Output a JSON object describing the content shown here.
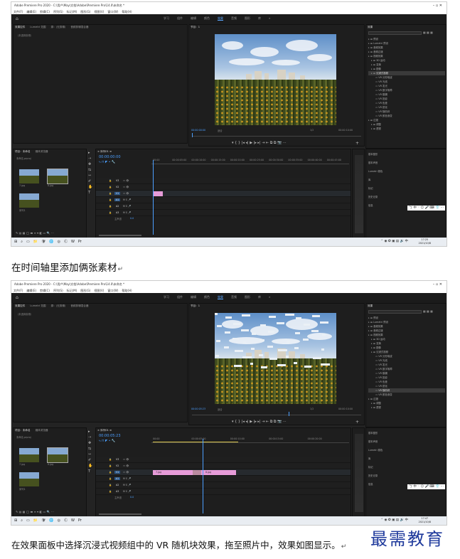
{
  "screens": [
    {
      "window_title": "Adobe Premiere Pro 2020 - C:\\用户\\May\\文档\\Adobe\\Premiere Pro\\14.0\\未命名 *",
      "menu": [
        "文件(F)",
        "编辑(E)",
        "剪辑(C)",
        "序列(S)",
        "标记(M)",
        "图形(G)",
        "视图(V)",
        "窗口(W)",
        "帮助(H)"
      ],
      "workspaces": [
        "学习",
        "组件",
        "编辑",
        "颜色",
        "效果",
        "音频",
        "图形",
        "库"
      ],
      "active_workspace": "效果",
      "source_tabs": [
        "效果控件",
        "Lumetri 范围",
        "源：(无剪辑)",
        "音频剪辑混合器"
      ],
      "source_empty": "（未选择剪辑）",
      "program_label": "节目：1",
      "program_timecode": "00:00:00:00",
      "fit": "适合",
      "quality": "1/2",
      "program_duration": "00:00:10:00",
      "project_tabs": [
        "项目：未命名",
        "媒体浏览器"
      ],
      "project_file": "未命名.prproj",
      "thumb_labels": [
        "7.jpg",
        "8.jpg",
        "序列1"
      ],
      "timeline_timecode": "00:00:00:00",
      "timeline_ticks": [
        "00:00",
        "00:00:05:00",
        "00:00:10:00",
        "00:00:15:00",
        "00:00:20:00",
        "00:00:25:00",
        "00:00:30:00",
        "00:00:35:00",
        "00:00:40:00",
        "00:00:45:00"
      ],
      "tracks": [
        "V3",
        "V2",
        "V1",
        "A1",
        "A2",
        "A3"
      ],
      "master": "主声道",
      "master_val": "0.0",
      "clips": [],
      "effects_title": "效果",
      "effects_tree": [
        "预设",
        "Lumetri 预设",
        "音频效果",
        "音频过渡",
        "视频效果",
        "3D 运动",
        "变换",
        "图像",
        "沉浸式视频",
        "VR 分形噪波",
        "VR 光线",
        "VR 发光",
        "VR 数字故障",
        "VR 模糊",
        "VR 投影",
        "VR 色差",
        "VR 锐化",
        "VR 随机块",
        "VR 颜色渐变",
        "过渡",
        "调整",
        "透视"
      ],
      "effects_selected": "沉浸式视频",
      "side_panels": [
        "基本图形",
        "基本声音",
        "Lumetri 颜色",
        "库",
        "标记",
        "历史记录",
        "信息"
      ],
      "taskbar_time": "17:25",
      "taskbar_date": "2021/10/8"
    },
    {
      "window_title": "Adobe Premiere Pro 2020 - C:\\用户\\May\\文档\\Adobe\\Premiere Pro\\14.0\\未命名 *",
      "menu": [
        "文件(F)",
        "编辑(E)",
        "剪辑(C)",
        "序列(S)",
        "标记(M)",
        "图形(G)",
        "视图(V)",
        "窗口(W)",
        "帮助(H)"
      ],
      "workspaces": [
        "学习",
        "组件",
        "编辑",
        "颜色",
        "效果",
        "音频",
        "图形",
        "库"
      ],
      "active_workspace": "效果",
      "source_tabs": [
        "效果控件",
        "Lumetri 范围",
        "源：(无剪辑)",
        "音频剪辑混合器"
      ],
      "source_empty": "（未选择剪辑）",
      "program_label": "节目：1",
      "program_timecode": "00:00:05:23",
      "fit": "适合",
      "quality": "1/2",
      "program_duration": "00:00:10:00",
      "project_tabs": [
        "项目：未命名",
        "媒体浏览器"
      ],
      "project_file": "未命名.prproj",
      "thumb_labels": [
        "7.jpg",
        "8.jpg",
        "序列1"
      ],
      "timeline_timecode": "00:00:05:23",
      "timeline_ticks": [
        "00:00",
        "00:00:05:00",
        "00:00:10:00",
        "00:00:15:00",
        "00:00:20:00"
      ],
      "tracks": [
        "V3",
        "V2",
        "V1",
        "A1",
        "A2",
        "A3"
      ],
      "master": "主声道",
      "master_val": "0.0",
      "clips": [
        "7.jpg",
        "8.jpg"
      ],
      "effects_title": "效果",
      "effects_tree": [
        "预设",
        "Lumetri 预设",
        "音频效果",
        "音频过渡",
        "视频效果",
        "3D 运动",
        "变换",
        "图像",
        "沉浸式视频",
        "VR 分形噪波",
        "VR 光线",
        "VR 发光",
        "VR 数字故障",
        "VR 模糊",
        "VR 投影",
        "VR 色差",
        "VR 锐化",
        "VR 随机块",
        "VR 颜色渐变",
        "过渡",
        "调整",
        "透视"
      ],
      "effects_selected": "VR 随机块",
      "side_panels": [
        "基本图形",
        "基本声音",
        "Lumetri 颜色",
        "库",
        "标记",
        "历史记录",
        "信息"
      ],
      "taskbar_time": "17:47",
      "taskbar_date": "2021/10/8"
    }
  ],
  "captions": [
    "在时间轴里添加俩张素材",
    "在效果面板中选择沉浸式视频组中的 VR 随机块效果，拖至照片中，效果如图显示。"
  ],
  "watermark": "最需教育"
}
